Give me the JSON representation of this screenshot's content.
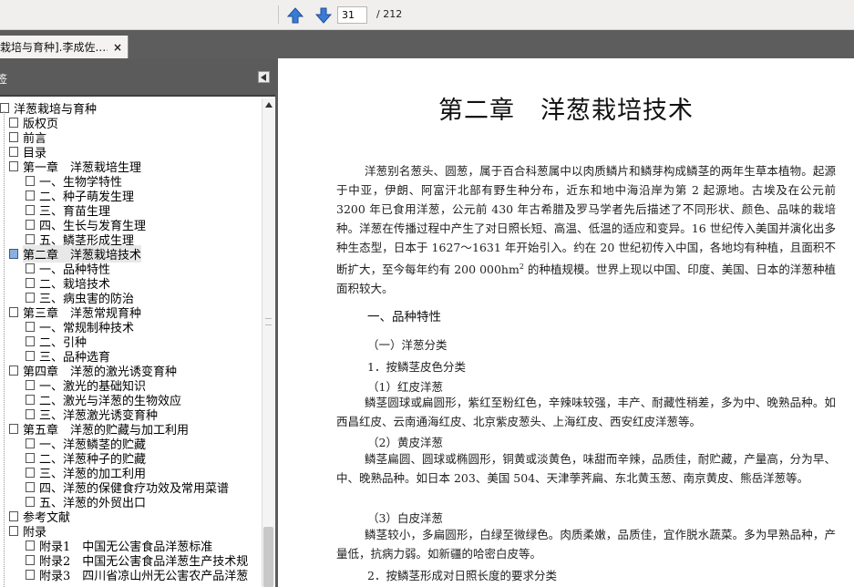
{
  "toolbar": {
    "prev_label": "previous-page",
    "next_label": "next-page",
    "page_current": "31",
    "page_total": "/ 212"
  },
  "tab": {
    "title": "栽培与育种].李成佐.…",
    "close": "×"
  },
  "sidebar": {
    "header": "签",
    "tree": [
      {
        "label": "洋葱栽培与育种",
        "level": 0,
        "active": false,
        "selected": false
      },
      {
        "label": "版权页",
        "level": 1,
        "active": false,
        "selected": false
      },
      {
        "label": "前言",
        "level": 1,
        "active": false,
        "selected": false
      },
      {
        "label": "目录",
        "level": 1,
        "active": false,
        "selected": false
      },
      {
        "label": "第一章　洋葱栽培生理",
        "level": 1,
        "active": false,
        "selected": false
      },
      {
        "label": "一、生物学特性",
        "level": 2,
        "active": false,
        "selected": false
      },
      {
        "label": "二、种子萌发生理",
        "level": 2,
        "active": false,
        "selected": false
      },
      {
        "label": "三、育苗生理",
        "level": 2,
        "active": false,
        "selected": false
      },
      {
        "label": "四、生长与发育生理",
        "level": 2,
        "active": false,
        "selected": false
      },
      {
        "label": "五、鳞茎形成生理",
        "level": 2,
        "active": false,
        "selected": false
      },
      {
        "label": "第二章　洋葱栽培技术",
        "level": 1,
        "active": true,
        "selected": true
      },
      {
        "label": "一、品种特性",
        "level": 2,
        "active": false,
        "selected": false
      },
      {
        "label": "二、栽培技术",
        "level": 2,
        "active": false,
        "selected": false
      },
      {
        "label": "三、病虫害的防治",
        "level": 2,
        "active": false,
        "selected": false
      },
      {
        "label": "第三章　洋葱常规育种",
        "level": 1,
        "active": false,
        "selected": false
      },
      {
        "label": "一、常规制种技术",
        "level": 2,
        "active": false,
        "selected": false
      },
      {
        "label": "二、引种",
        "level": 2,
        "active": false,
        "selected": false
      },
      {
        "label": "三、品种选育",
        "level": 2,
        "active": false,
        "selected": false
      },
      {
        "label": "第四章　洋葱的激光诱变育种",
        "level": 1,
        "active": false,
        "selected": false
      },
      {
        "label": "一、激光的基础知识",
        "level": 2,
        "active": false,
        "selected": false
      },
      {
        "label": "二、激光与洋葱的生物效应",
        "level": 2,
        "active": false,
        "selected": false
      },
      {
        "label": "三、洋葱激光诱变育种",
        "level": 2,
        "active": false,
        "selected": false
      },
      {
        "label": "第五章　洋葱的贮藏与加工利用",
        "level": 1,
        "active": false,
        "selected": false
      },
      {
        "label": "一、洋葱鳞茎的贮藏",
        "level": 2,
        "active": false,
        "selected": false
      },
      {
        "label": "二、洋葱种子的贮藏",
        "level": 2,
        "active": false,
        "selected": false
      },
      {
        "label": "三、洋葱的加工利用",
        "level": 2,
        "active": false,
        "selected": false
      },
      {
        "label": "四、洋葱的保健食疗功效及常用菜谱",
        "level": 2,
        "active": false,
        "selected": false
      },
      {
        "label": "五、洋葱的外贸出口",
        "level": 2,
        "active": false,
        "selected": false
      },
      {
        "label": "参考文献",
        "level": 1,
        "active": false,
        "selected": false
      },
      {
        "label": "附录",
        "level": 1,
        "active": false,
        "selected": false
      },
      {
        "label": "附录1　中国无公害食品洋葱标准",
        "level": 2,
        "active": false,
        "selected": false
      },
      {
        "label": "附录2　中国无公害食品洋葱生产技术规",
        "level": 2,
        "active": false,
        "selected": false
      },
      {
        "label": "附录3　四川省凉山州无公害农产品洋葱",
        "level": 2,
        "active": false,
        "selected": false
      }
    ]
  },
  "document": {
    "chapter_title": "第二章　洋葱栽培技术",
    "intro_1": "洋葱别名葱头、圆葱，属于百合科葱属中以肉质鳞片和鳞芽构成鳞茎的两年生草本植物。起源于中亚，伊朗、阿富汗北部有野生种分布，近东和地中海沿岸为第 2 起源地。古埃及在公元前 3200 年已食用洋葱，公元前 430 年古希腊及罗马学者先后描述了不同形状、颜色、品味的栽培种。洋葱在传播过程中产生了对日照长短、高温、低温的适应和变异。16 世纪传入美国并演化出多种生态型，日本于 1627～1631 年开始引入。约在 20 世纪初传入中国，各地均有种植，且面积不断扩大，至今每年约有 200 000hm",
    "intro_sup": "2",
    "intro_2": " 的种植规模。世界上现以中国、印度、美国、日本的洋葱种植面积较大。",
    "section_1": "一、品种特性",
    "sub_1": "（一）洋葱分类",
    "item_1": "1．按鳞茎皮色分类",
    "red_head": "（1）红皮洋葱",
    "red_body": "鳞茎圆球或扁圆形，紫红至粉红色，辛辣味较强，丰产、耐藏性稍差，多为中、晚熟品种。如西昌红皮、云南通海红皮、北京紫皮葱头、上海红皮、西安红皮洋葱等。",
    "yellow_head": "（2）黄皮洋葱",
    "yellow_body": "鳞茎扁圆、圆球或椭圆形，铜黄或淡黄色，味甜而辛辣，品质佳，耐贮藏，产量高，分为早、中、晚熟品种。如日本 203、美国 504、天津荸荠扁、东北黄玉葱、南京黄皮、熊岳洋葱等。",
    "white_head": "（3）白皮洋葱",
    "white_body": "鳞茎较小，多扁圆形，白绿至微绿色。肉质柔嫩，品质佳，宜作脱水蔬菜。多为早熟品种，产量低，抗病力弱。如新疆的哈密白皮等。",
    "item_2": "2．按鳞茎形成对日照长度的要求分类"
  }
}
